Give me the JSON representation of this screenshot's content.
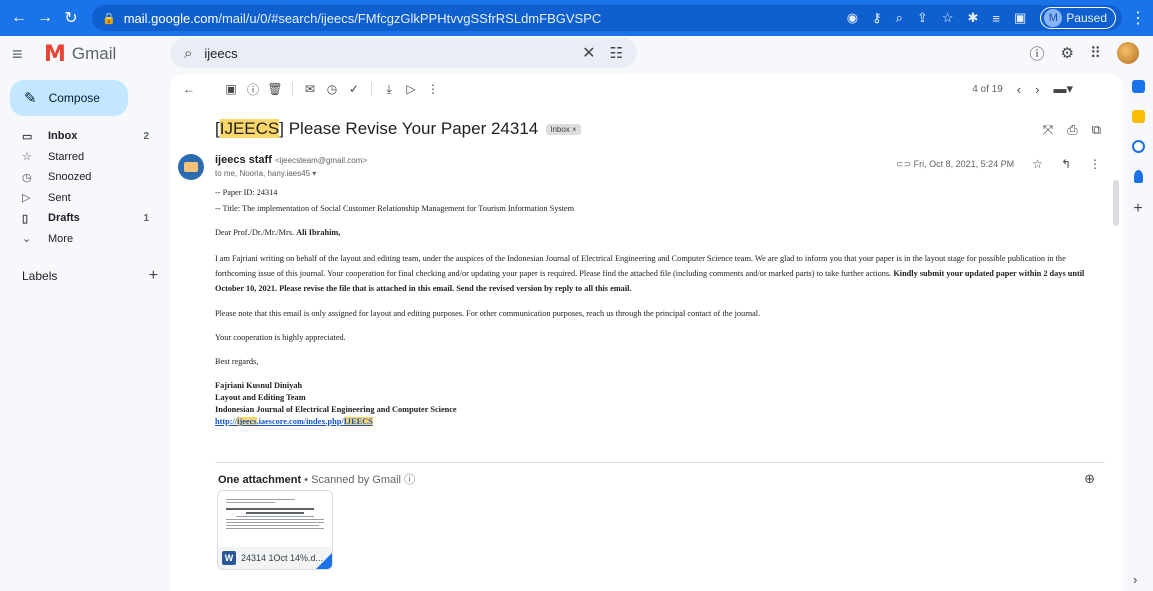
{
  "browser": {
    "url_domain": "mail.google.com",
    "url_path": "/mail/u/0/#search/ijeecs/FMfcgzGlkPPHtvvgSSfrRSLdmFBGVSPC",
    "profile_initial": "M",
    "profile_status": "Paused"
  },
  "app": {
    "name": "Gmail"
  },
  "search": {
    "value": "ijeecs"
  },
  "compose": {
    "label": "Compose"
  },
  "nav": [
    {
      "icon": "inbox-icon",
      "label": "Inbox",
      "count": "2",
      "bold": true
    },
    {
      "icon": "star-icon",
      "label": "Starred",
      "count": ""
    },
    {
      "icon": "clock-icon",
      "label": "Snoozed",
      "count": ""
    },
    {
      "icon": "send-icon",
      "label": "Sent",
      "count": ""
    },
    {
      "icon": "draft-icon",
      "label": "Drafts",
      "count": "1",
      "bold": true
    },
    {
      "icon": "chevron-down-icon",
      "label": "More",
      "count": ""
    }
  ],
  "labels": {
    "title": "Labels"
  },
  "toolbar": {
    "pager": "4 of 19"
  },
  "email": {
    "subject_hl": "IJEECS",
    "subject_rest": "Please Revise Your Paper 24314",
    "badge": "Inbox",
    "sender_name": "ijeecs staff",
    "sender_email": "<ijeecsteam@gmail.com>",
    "to": "to me, Nooria, hany.iaes45",
    "date": "Fri, Oct 8, 2021, 5:24 PM",
    "line1": "-- Paper ID: 24314",
    "line2": "-- Title: The implementation of Social Customer Relationship Management for Tourism Information System",
    "greeting_prefix": "Dear Prof./Dr./Mr./Mrs.",
    "greeting_name": "Ali Ibrahim,",
    "para1": "I am Fajriani writing on behalf of the layout and editing team, under the auspices of the Indonesian Journal of Electrical Engineering and Computer Science team. We are glad to inform you that your paper is in the layout stage for possible publication in the forthcoming issue of this journal. Your cooperation for final checking and/or updating your paper is required. Please find the attached file (including comments and/or marked parts) to take further actions.",
    "para1_bold": "Kindly submit your updated paper within 2 days until October 10, 2021. Please revise the file that is attached in this email. Send the revised version by reply to all this email.",
    "para2": "Please note that this email is only assigned for layout and editing purposes. For other communication purposes, reach us through the principal contact of the journal.",
    "para3": "Your cooperation is highly appreciated.",
    "closing": "Best regards,",
    "sig_name": "Fajriani Kusnul Diniyah",
    "sig_team": "Layout and Editing Team",
    "sig_journal": "Indonesian Journal of Electrical Engineering and Computer Science",
    "link_a": "http://",
    "link_b": "ijeecs",
    "link_c": ".iaescore.com/index.php/",
    "link_d": "IJEECS"
  },
  "attachment": {
    "title": "One attachment",
    "scanned": "• Scanned by Gmail",
    "filename": "24314 1Oct 14%.d..."
  }
}
